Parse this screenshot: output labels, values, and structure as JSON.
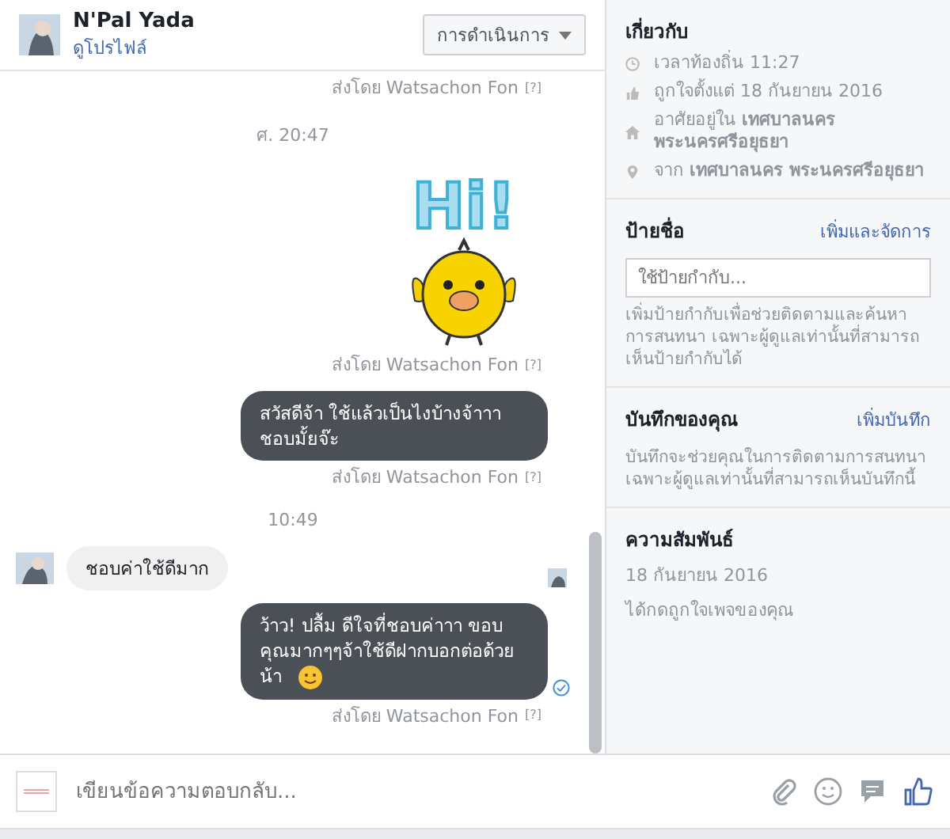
{
  "header": {
    "name": "N'Pal Yada",
    "profile_link": "ดูโปรไฟล์",
    "action_button": "การดำเนินการ"
  },
  "messages": [
    {
      "kind": "sender",
      "text": "ส่งโดย Watsachon Fon",
      "help": "[?]"
    },
    {
      "kind": "time",
      "text": "ศ. 20:47"
    },
    {
      "kind": "sticker",
      "text": "Hi!"
    },
    {
      "kind": "sender",
      "text": "ส่งโดย Watsachon Fon",
      "help": "[?]"
    },
    {
      "kind": "outgoing",
      "text": "สวัสดีจ้า ใช้แล้วเป็นไงบ้างจ้าาา ชอบมั้ยจ๊ะ",
      "emoji": false,
      "delivered": false
    },
    {
      "kind": "sender",
      "text": "ส่งโดย Watsachon Fon",
      "help": "[?]"
    },
    {
      "kind": "time",
      "text": "10:49"
    },
    {
      "kind": "incoming",
      "text": "ชอบค่าใช้ดีมาก",
      "seen": true
    },
    {
      "kind": "outgoing",
      "text": "ว้าว! ปลื้ม ดีใจที่ชอบค่าาา ขอบคุณมากๆๆจ้าใช้ดีฝากบอกต่อด้วยน้า",
      "emoji": true,
      "delivered": true
    },
    {
      "kind": "sender",
      "text": "ส่งโดย Watsachon Fon",
      "help": "[?]"
    }
  ],
  "composer": {
    "placeholder": "เขียนข้อความตอบกลับ..."
  },
  "about": {
    "title": "เกี่ยวกับ",
    "items": [
      {
        "kind": "clock",
        "text": "เวลาท้องถิ่น 11:27"
      },
      {
        "kind": "like",
        "text": "ถูกใจตั้งแต่ 18 กันยายน 2016"
      },
      {
        "kind": "home",
        "text": "อาศัยอยู่ใน **เทศบาลนคร พระนครศรีอยุธยา**"
      },
      {
        "kind": "pin",
        "text": "จาก **เทศบาลนคร พระนครศรีอยุธยา**"
      }
    ]
  },
  "labels": {
    "title": "ป้ายชื่อ",
    "action": "เพิ่มและจัดการ",
    "placeholder": "ใช้ป้ายกำกับ...",
    "description": "เพิ่มป้ายกำกับเพื่อช่วยติดตามและค้นหาการสนทนา เฉพาะผู้ดูแลเท่านั้นที่สามารถเห็นป้ายกำกับได้"
  },
  "notes": {
    "title": "บันทึกของคุณ",
    "action": "เพิ่มบันทึก",
    "description": "บันทึกจะช่วยคุณในการติดตามการสนทนา เฉพาะผู้ดูแลเท่านั้นที่สามารถเห็นบันทึกนี้"
  },
  "relationship": {
    "title": "ความสัมพันธ์",
    "date": "18 กันยายน 2016",
    "text": "ได้กดถูกใจเพจของคุณ"
  }
}
